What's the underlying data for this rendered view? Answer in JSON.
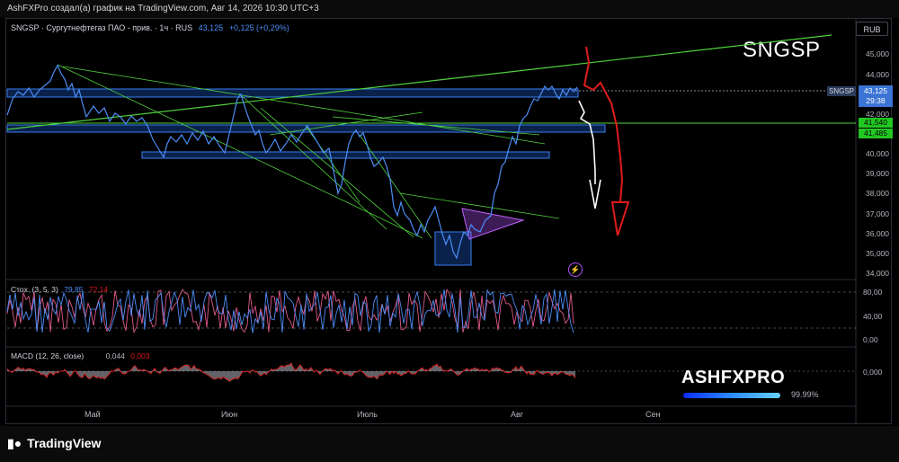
{
  "header": {
    "title": "AshFXPro создал(а) график на TradingView.com, Авг 14, 2026 10:30 UTC+3"
  },
  "symbol_info": {
    "description": "SNGSP · Сургутнефтегаз ПАО - прив. · 1ч · RUS",
    "price": "43,125",
    "change": "+0,125 (+0,29%)"
  },
  "currency": "RUB",
  "annotation_symbol": "SNGSP",
  "price_axis": {
    "labels": [
      "45,000",
      "44,000",
      "43,000",
      "42,000",
      "41,000",
      "40,000",
      "39,000",
      "38,000",
      "37,000",
      "36,000",
      "35,000",
      "34,000"
    ]
  },
  "price_tags": {
    "symbol": "SNGSP",
    "current": "43,125",
    "countdown": "29:38",
    "level1": "41,540",
    "level2": "41,485"
  },
  "stoch": {
    "legend": "Стох. (3, 5, 3)",
    "k": "79,85",
    "d": "72,14",
    "axis": [
      "80,00",
      "40,00",
      "0,00"
    ]
  },
  "macd": {
    "legend": "MACD (12, 26, close)",
    "v1": "0,044",
    "v2": "0,003",
    "axis": [
      "0,000"
    ]
  },
  "time_axis": {
    "labels": [
      "Май",
      "Июн",
      "Июль",
      "Авг",
      "Сен"
    ]
  },
  "branding": {
    "name": "ASHFXPRO",
    "pct": "99.99%"
  },
  "footer": {
    "logo_text": "TradingView"
  },
  "colors": {
    "price_line": "#4c8df6",
    "support_zone": "#1e5fd6",
    "trend_line": "#4fd13c",
    "bear_arrow": "#e01b1b",
    "white_arrow": "#ffffff",
    "stoch_k": "#4c8df6",
    "stoch_d": "#e05a8a",
    "macd_hist": "#b2b5be"
  }
}
